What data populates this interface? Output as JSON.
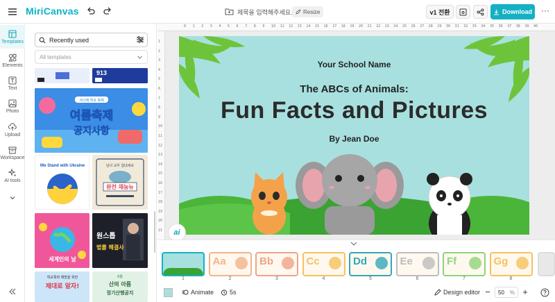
{
  "header": {
    "logo_text": "MiriCanvas",
    "doc_title_placeholder": "제목을 입력해주세요.",
    "resize_label": "Resize",
    "version_label": "v1 전환",
    "download_label": "Download",
    "more_label": "···"
  },
  "rail": {
    "items": [
      {
        "label": "Templates",
        "icon": "templates-icon"
      },
      {
        "label": "Elements",
        "icon": "elements-icon"
      },
      {
        "label": "Text",
        "icon": "text-icon"
      },
      {
        "label": "Photo",
        "icon": "photo-icon"
      },
      {
        "label": "Upload",
        "icon": "upload-icon"
      },
      {
        "label": "Workspace",
        "icon": "workspace-icon"
      },
      {
        "label": "AI tools",
        "icon": "ai-tools-icon"
      }
    ]
  },
  "panel": {
    "search_value": "Recently used",
    "filter_label": "All templates",
    "thumb_texts": {
      "festival_top": "서나래 학교 축제",
      "festival_title": "여름축제",
      "festival_sub": "공지사항",
      "ukraine": "We Stand with Ukraine",
      "fish_top": "남녀 교우 힘내세요",
      "fish_title": "완전 재능뉴",
      "world": "세계인의 날",
      "lecture_title": "원스톱",
      "lecture_sub": "법률 해결사",
      "notice_top": "학교폭력 예방을 위한",
      "notice_title": "제대로 알자!",
      "mountain_top": "6월",
      "mountain_title": "산의 아름",
      "mountain_sub": "정기산행공지"
    }
  },
  "slide": {
    "school": "Your School Name",
    "subtitle": "The ABCs of Animals:",
    "title": "Fun Facts and Pictures",
    "author": "By Jean Doe",
    "bg_color": "#a8e0df"
  },
  "pages": [
    {
      "num": "1",
      "letter": "",
      "color": "#a8e0df"
    },
    {
      "num": "2",
      "letter": "Aa",
      "color": "#f3b38a"
    },
    {
      "num": "3",
      "letter": "Bb",
      "color": "#f0a38a"
    },
    {
      "num": "4",
      "letter": "Cc",
      "color": "#f6c25b"
    },
    {
      "num": "5",
      "letter": "Dd",
      "color": "#33a8b8"
    },
    {
      "num": "6",
      "letter": "Ee",
      "color": "#bdbdbd"
    },
    {
      "num": "7",
      "letter": "Ff",
      "color": "#8fd47a"
    },
    {
      "num": "8",
      "letter": "Gg",
      "color": "#f6c25b"
    }
  ],
  "bottombar": {
    "animate_label": "Animate",
    "timer_label": "5s",
    "design_editor_label": "Design editor",
    "zoom_value": "50",
    "zoom_unit": "%"
  },
  "ruler_h": [
    "0",
    "1",
    "2",
    "3",
    "4",
    "5",
    "6",
    "7",
    "8",
    "9",
    "10",
    "11",
    "12",
    "13",
    "14",
    "15",
    "16",
    "17",
    "18",
    "19",
    "20",
    "21",
    "22",
    "23",
    "24",
    "25",
    "26",
    "27",
    "28",
    "29",
    "30",
    "31",
    "32",
    "33",
    "34",
    "35",
    "36",
    "37",
    "38",
    "39",
    "40"
  ],
  "ruler_v": [
    "1",
    "2",
    "3",
    "4",
    "5",
    "6",
    "7",
    "8",
    "9",
    "10",
    "11",
    "12",
    "13",
    "14",
    "15",
    "16",
    "17",
    "18",
    "19",
    "20",
    "21"
  ]
}
